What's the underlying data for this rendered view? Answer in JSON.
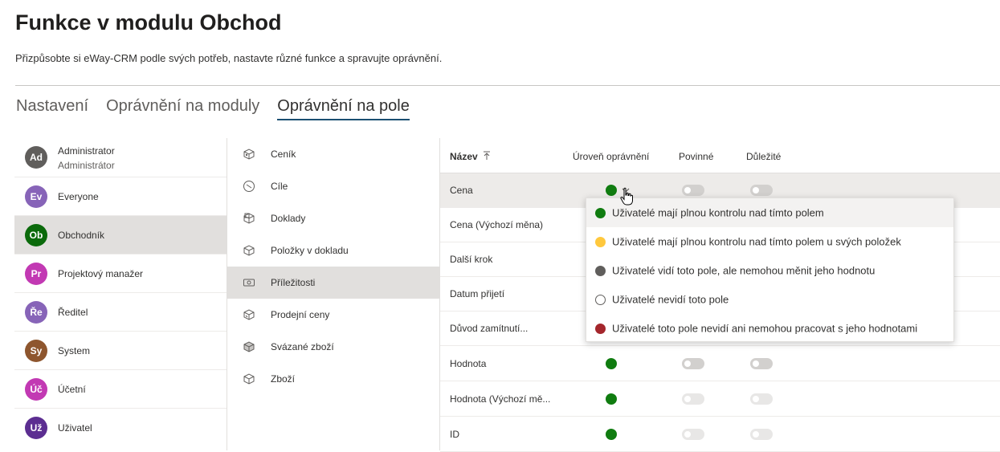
{
  "page": {
    "title": "Funkce v modulu Obchod",
    "subtitle": "Přizpůsobte si eWay-CRM podle svých potřeb, nastavte různé funkce a spravujte oprávnění."
  },
  "tabs": [
    {
      "label": "Nastavení",
      "active": false
    },
    {
      "label": "Oprávnění na moduly",
      "active": false
    },
    {
      "label": "Oprávnění na pole",
      "active": true
    }
  ],
  "roles": [
    {
      "initials": "Ad",
      "name": "Administrator",
      "sub": "Administrátor",
      "color": "#605e5c"
    },
    {
      "initials": "Ev",
      "name": "Everyone",
      "color": "#8764b8"
    },
    {
      "initials": "Ob",
      "name": "Obchodník",
      "color": "#0b6a0b",
      "selected": true
    },
    {
      "initials": "Pr",
      "name": "Projektový manažer",
      "color": "#c239b3"
    },
    {
      "initials": "Ře",
      "name": "Ředitel",
      "color": "#8764b8"
    },
    {
      "initials": "Sy",
      "name": "System",
      "color": "#8e562e"
    },
    {
      "initials": "Úč",
      "name": "Účetní",
      "color": "#c239b3"
    },
    {
      "initials": "Už",
      "name": "Uživatel",
      "color": "#5c2e91"
    }
  ],
  "modules": [
    {
      "label": "Ceník",
      "icon": "price-list-icon"
    },
    {
      "label": "Cíle",
      "icon": "goals-icon"
    },
    {
      "label": "Doklady",
      "icon": "documents-icon"
    },
    {
      "label": "Položky v dokladu",
      "icon": "document-items-icon"
    },
    {
      "label": "Příležitosti",
      "icon": "opportunities-icon",
      "selected": true
    },
    {
      "label": "Prodejní ceny",
      "icon": "sale-prices-icon"
    },
    {
      "label": "Svázané zboží",
      "icon": "bundled-products-icon"
    },
    {
      "label": "Zboží",
      "icon": "products-icon"
    }
  ],
  "table": {
    "headers": {
      "name": "Název",
      "level": "Úroveň oprávnění",
      "required": "Povinné",
      "important": "Důležité"
    },
    "sort_icon": "sort-ascending-icon",
    "rows": [
      {
        "name": "Cena",
        "level_color": "#107c10"
      },
      {
        "name": "Cena (Výchozí měna)"
      },
      {
        "name": "Další krok"
      },
      {
        "name": "Datum přijetí"
      },
      {
        "name": "Důvod zamítnutí..."
      },
      {
        "name": "Hodnota",
        "level_color": "#107c10"
      },
      {
        "name": "Hodnota (Výchozí mě...",
        "level_color": "#107c10"
      },
      {
        "name": "ID",
        "level_color": "#107c10"
      }
    ]
  },
  "permission_dropdown": {
    "options": [
      {
        "label": "Uživatelé mají plnou kontrolu nad tímto polem",
        "color": "#107c10"
      },
      {
        "label": "Uživatelé mají plnou kontrolu nad tímto polem u svých položek",
        "color": "#ffc83d"
      },
      {
        "label": "Uživatelé vidí toto pole, ale nemohou měnit jeho hodnotu",
        "color": "#605e5c"
      },
      {
        "label": "Uživatelé nevidí toto pole",
        "color": "#ffffff"
      },
      {
        "label": "Uživatelé toto pole nevidí ani nemohou pracovat s jeho hodnotami",
        "color": "#a4262c"
      }
    ]
  }
}
